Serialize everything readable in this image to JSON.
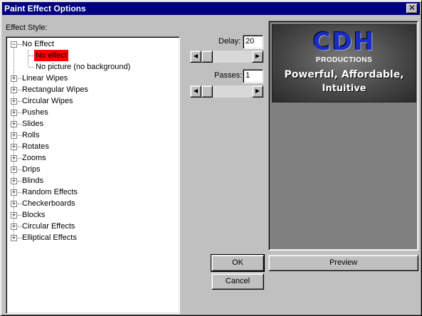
{
  "window": {
    "title": "Paint Effect Options",
    "close_glyph": "✕"
  },
  "effect_style": {
    "label": "Effect Style:"
  },
  "tree": [
    {
      "label": "No Effect",
      "expanded": true,
      "children": [
        {
          "label": "No effect",
          "selected": true
        },
        {
          "label": "No picture (no background)",
          "selected": false
        }
      ]
    },
    {
      "label": "Linear Wipes",
      "expanded": false
    },
    {
      "label": "Rectangular Wipes",
      "expanded": false
    },
    {
      "label": "Circular Wipes",
      "expanded": false
    },
    {
      "label": "Pushes",
      "expanded": false
    },
    {
      "label": "Slides",
      "expanded": false
    },
    {
      "label": "Rolls",
      "expanded": false
    },
    {
      "label": "Rotates",
      "expanded": false
    },
    {
      "label": "Zooms",
      "expanded": false
    },
    {
      "label": "Drips",
      "expanded": false
    },
    {
      "label": "Blinds",
      "expanded": false
    },
    {
      "label": "Random Effects",
      "expanded": false
    },
    {
      "label": "Checkerboards",
      "expanded": false
    },
    {
      "label": "Blocks",
      "expanded": false
    },
    {
      "label": "Circular Effects",
      "expanded": false
    },
    {
      "label": "Elliptical Effects",
      "expanded": false
    }
  ],
  "delay": {
    "label": "Delay:",
    "value": "20"
  },
  "passes": {
    "label": "Passes:",
    "value": "1"
  },
  "preview_image": {
    "line1": "CDH",
    "line2": "PRODUCTIONS",
    "line3": "Powerful, Affordable,",
    "line4": "Intuitive"
  },
  "buttons": {
    "ok": "OK",
    "cancel": "Cancel",
    "preview": "Preview"
  },
  "icons": {
    "expand": "+",
    "collapse": "−",
    "scroll_left": "◀",
    "scroll_right": "▶"
  },
  "colors": {
    "title_bar": "#000080",
    "selection": "#ff0000",
    "face": "#c0c0c0"
  }
}
